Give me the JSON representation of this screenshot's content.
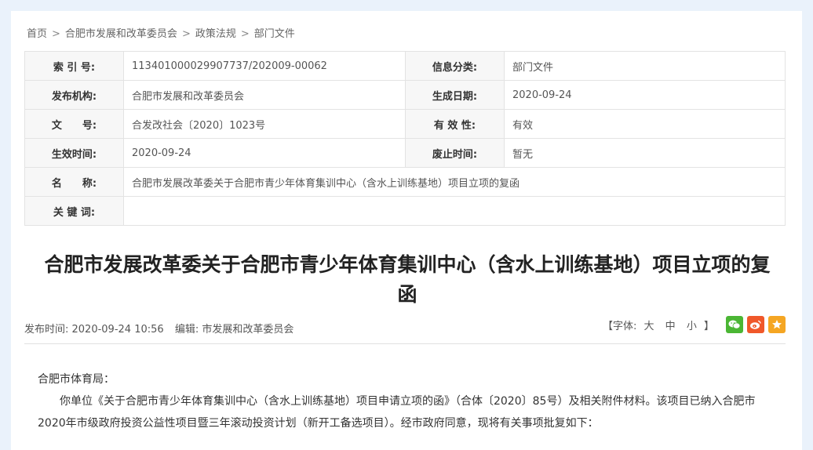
{
  "breadcrumb": [
    "首页",
    "合肥市发展和改革委员会",
    "政策法规",
    "部门文件"
  ],
  "meta": {
    "index_label": "索 引 号:",
    "index_value": "11340100002990773 7/202009-00062",
    "category_label": "信息分类:",
    "category_value": "部门文件",
    "publisher_label": "发布机构:",
    "publisher_value": "合肥市发展和改革委员会",
    "date_label": "生成日期:",
    "date_value": "2020-09-24",
    "docno_label": "文　　号:",
    "docno_value": "合发改社会〔2020〕1023号",
    "valid_label": "有 效 性:",
    "valid_value": "有效",
    "effective_label": "生效时间:",
    "effective_value": "2020-09-24",
    "abolish_label": "废止时间:",
    "abolish_value": "暂无",
    "name_label": "名　　称:",
    "name_value": "合肥市发展改革委关于合肥市青少年体育集训中心（含水上训练基地）项目立项的复函",
    "keyword_label": "关 键 词:",
    "keyword_value": ""
  },
  "title": "合肥市发展改革委关于合肥市青少年体育集训中心（含水上训练基地）项目立项的复函",
  "info": {
    "publish_time": "发布时间:  2020-09-24 10:56",
    "editor": "编辑:  市发展和改革委员会",
    "font_label": "【字体:",
    "font_large": "大",
    "font_medium": "中",
    "font_small": "小",
    "font_close": "】"
  },
  "share": [
    {
      "name": "wechat-icon",
      "color": "#4bb634"
    },
    {
      "name": "weibo-icon",
      "color": "#f0582a"
    },
    {
      "name": "favorite-icon",
      "color": "#f5a623"
    }
  ],
  "body": {
    "salutation": "合肥市体育局：",
    "para1": "你单位《关于合肥市青少年体育集训中心（含水上训练基地）项目申请立项的函》（合体〔2020〕85号）及相关附件材料。该项目已纳入合肥市2020年市级政府投资公益性项目暨三年滚动投资计划（新开工备选项目）。经市政府同意，现将有关事项批复如下："
  }
}
